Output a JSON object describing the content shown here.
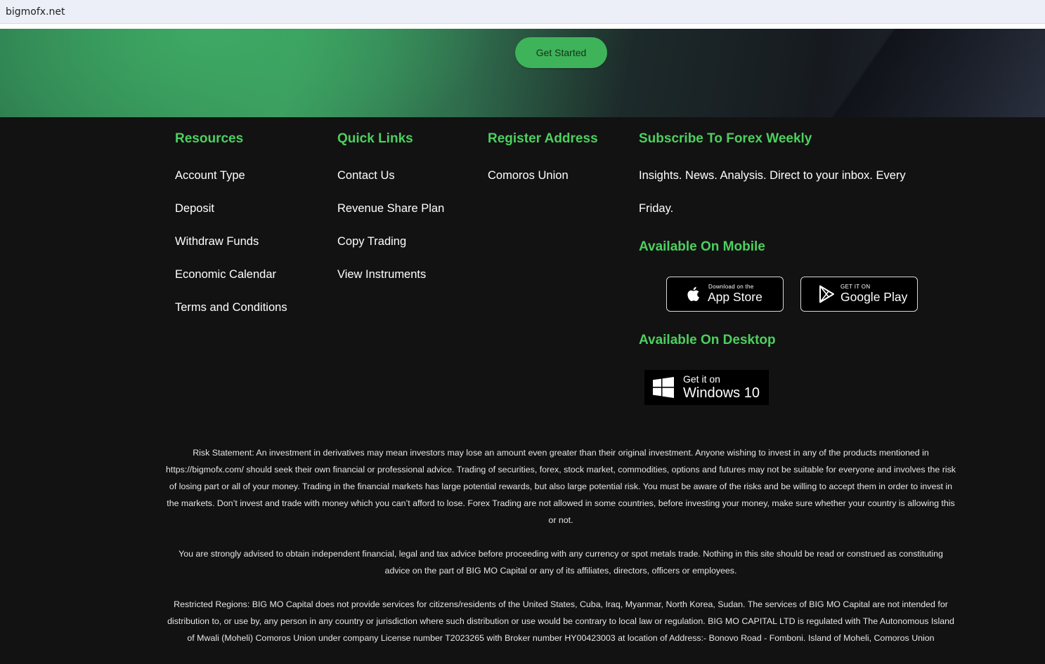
{
  "browser": {
    "url": "bigmofx.net"
  },
  "hero": {
    "cta_label": "Get Started"
  },
  "resources": {
    "title": "Resources",
    "items": [
      "Account Type",
      "Deposit",
      "Withdraw Funds",
      "Economic Calendar",
      "Terms and Conditions"
    ]
  },
  "quick_links": {
    "title": "Quick Links",
    "items": [
      "Contact Us",
      "Revenue Share Plan",
      "Copy Trading",
      "View Instruments"
    ]
  },
  "register": {
    "title": "Register Address",
    "address": "Comoros Union"
  },
  "subscribe": {
    "title": "Subscribe To Forex Weekly",
    "line1": "Insights. News. Analysis. Direct to your inbox. Every",
    "line2": "Friday."
  },
  "mobile": {
    "title": "Available On Mobile",
    "appstore_small": "Download on the",
    "appstore_big": "App Store",
    "googleplay_small": "GET IT ON",
    "googleplay_big": "Google Play"
  },
  "desktop": {
    "title": "Available On Desktop",
    "windows_small": "Get it on",
    "windows_big": "Windows 10"
  },
  "disclaimers": {
    "risk": "Risk Statement: An investment in derivatives may mean investors may lose an amount even greater than their original investment. Anyone wishing to invest in any of the products mentioned in https://bigmofx.com/ should seek their own financial or professional advice. Trading of securities, forex, stock market, commodities, options and futures may not be suitable for everyone and involves the risk of losing part or all of your money. Trading in the financial markets has large potential rewards, but also large potential risk. You must be aware of the risks and be willing to accept them in order to invest in the markets. Don’t invest and trade with money which you can’t afford to lose. Forex Trading are not allowed in some countries, before investing your money, make sure whether your country is allowing this or not.",
    "advice": "You are strongly advised to obtain independent financial, legal and tax advice before proceeding with any currency or spot metals trade. Nothing in this site should be read or construed as constituting advice on the part of BIG MO Capital or any of its affiliates, directors, officers or employees.",
    "restricted": "Restricted Regions: BIG MO Capital does not provide services for citizens/residents of the United States, Cuba, Iraq, Myanmar, North Korea, Sudan. The services of BIG MO Capital are not intended for distribution to, or use by, any person in any country or jurisdiction where such distribution or use would be contrary to local law or regulation. BIG MO CAPITAL LTD is regulated with The Autonomous Island of Mwali (Moheli) Comoros Union under company License number T2023265 with Broker number HY00423003 at location of Address:- Bonovo Road - Fomboni. Island of Moheli, Comoros Union"
  }
}
